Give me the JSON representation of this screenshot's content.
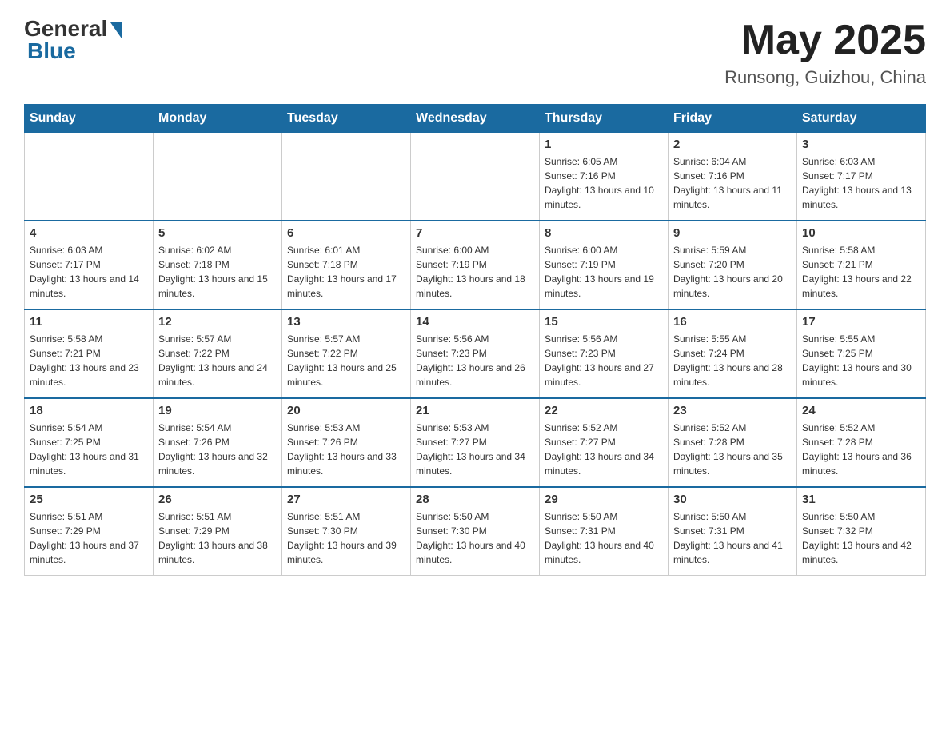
{
  "header": {
    "logo_general": "General",
    "logo_blue": "Blue",
    "month_title": "May 2025",
    "location": "Runsong, Guizhou, China"
  },
  "weekdays": [
    "Sunday",
    "Monday",
    "Tuesday",
    "Wednesday",
    "Thursday",
    "Friday",
    "Saturday"
  ],
  "weeks": [
    [
      {
        "day": "",
        "sunrise": "",
        "sunset": "",
        "daylight": ""
      },
      {
        "day": "",
        "sunrise": "",
        "sunset": "",
        "daylight": ""
      },
      {
        "day": "",
        "sunrise": "",
        "sunset": "",
        "daylight": ""
      },
      {
        "day": "",
        "sunrise": "",
        "sunset": "",
        "daylight": ""
      },
      {
        "day": "1",
        "sunrise": "Sunrise: 6:05 AM",
        "sunset": "Sunset: 7:16 PM",
        "daylight": "Daylight: 13 hours and 10 minutes."
      },
      {
        "day": "2",
        "sunrise": "Sunrise: 6:04 AM",
        "sunset": "Sunset: 7:16 PM",
        "daylight": "Daylight: 13 hours and 11 minutes."
      },
      {
        "day": "3",
        "sunrise": "Sunrise: 6:03 AM",
        "sunset": "Sunset: 7:17 PM",
        "daylight": "Daylight: 13 hours and 13 minutes."
      }
    ],
    [
      {
        "day": "4",
        "sunrise": "Sunrise: 6:03 AM",
        "sunset": "Sunset: 7:17 PM",
        "daylight": "Daylight: 13 hours and 14 minutes."
      },
      {
        "day": "5",
        "sunrise": "Sunrise: 6:02 AM",
        "sunset": "Sunset: 7:18 PM",
        "daylight": "Daylight: 13 hours and 15 minutes."
      },
      {
        "day": "6",
        "sunrise": "Sunrise: 6:01 AM",
        "sunset": "Sunset: 7:18 PM",
        "daylight": "Daylight: 13 hours and 17 minutes."
      },
      {
        "day": "7",
        "sunrise": "Sunrise: 6:00 AM",
        "sunset": "Sunset: 7:19 PM",
        "daylight": "Daylight: 13 hours and 18 minutes."
      },
      {
        "day": "8",
        "sunrise": "Sunrise: 6:00 AM",
        "sunset": "Sunset: 7:19 PM",
        "daylight": "Daylight: 13 hours and 19 minutes."
      },
      {
        "day": "9",
        "sunrise": "Sunrise: 5:59 AM",
        "sunset": "Sunset: 7:20 PM",
        "daylight": "Daylight: 13 hours and 20 minutes."
      },
      {
        "day": "10",
        "sunrise": "Sunrise: 5:58 AM",
        "sunset": "Sunset: 7:21 PM",
        "daylight": "Daylight: 13 hours and 22 minutes."
      }
    ],
    [
      {
        "day": "11",
        "sunrise": "Sunrise: 5:58 AM",
        "sunset": "Sunset: 7:21 PM",
        "daylight": "Daylight: 13 hours and 23 minutes."
      },
      {
        "day": "12",
        "sunrise": "Sunrise: 5:57 AM",
        "sunset": "Sunset: 7:22 PM",
        "daylight": "Daylight: 13 hours and 24 minutes."
      },
      {
        "day": "13",
        "sunrise": "Sunrise: 5:57 AM",
        "sunset": "Sunset: 7:22 PM",
        "daylight": "Daylight: 13 hours and 25 minutes."
      },
      {
        "day": "14",
        "sunrise": "Sunrise: 5:56 AM",
        "sunset": "Sunset: 7:23 PM",
        "daylight": "Daylight: 13 hours and 26 minutes."
      },
      {
        "day": "15",
        "sunrise": "Sunrise: 5:56 AM",
        "sunset": "Sunset: 7:23 PM",
        "daylight": "Daylight: 13 hours and 27 minutes."
      },
      {
        "day": "16",
        "sunrise": "Sunrise: 5:55 AM",
        "sunset": "Sunset: 7:24 PM",
        "daylight": "Daylight: 13 hours and 28 minutes."
      },
      {
        "day": "17",
        "sunrise": "Sunrise: 5:55 AM",
        "sunset": "Sunset: 7:25 PM",
        "daylight": "Daylight: 13 hours and 30 minutes."
      }
    ],
    [
      {
        "day": "18",
        "sunrise": "Sunrise: 5:54 AM",
        "sunset": "Sunset: 7:25 PM",
        "daylight": "Daylight: 13 hours and 31 minutes."
      },
      {
        "day": "19",
        "sunrise": "Sunrise: 5:54 AM",
        "sunset": "Sunset: 7:26 PM",
        "daylight": "Daylight: 13 hours and 32 minutes."
      },
      {
        "day": "20",
        "sunrise": "Sunrise: 5:53 AM",
        "sunset": "Sunset: 7:26 PM",
        "daylight": "Daylight: 13 hours and 33 minutes."
      },
      {
        "day": "21",
        "sunrise": "Sunrise: 5:53 AM",
        "sunset": "Sunset: 7:27 PM",
        "daylight": "Daylight: 13 hours and 34 minutes."
      },
      {
        "day": "22",
        "sunrise": "Sunrise: 5:52 AM",
        "sunset": "Sunset: 7:27 PM",
        "daylight": "Daylight: 13 hours and 34 minutes."
      },
      {
        "day": "23",
        "sunrise": "Sunrise: 5:52 AM",
        "sunset": "Sunset: 7:28 PM",
        "daylight": "Daylight: 13 hours and 35 minutes."
      },
      {
        "day": "24",
        "sunrise": "Sunrise: 5:52 AM",
        "sunset": "Sunset: 7:28 PM",
        "daylight": "Daylight: 13 hours and 36 minutes."
      }
    ],
    [
      {
        "day": "25",
        "sunrise": "Sunrise: 5:51 AM",
        "sunset": "Sunset: 7:29 PM",
        "daylight": "Daylight: 13 hours and 37 minutes."
      },
      {
        "day": "26",
        "sunrise": "Sunrise: 5:51 AM",
        "sunset": "Sunset: 7:29 PM",
        "daylight": "Daylight: 13 hours and 38 minutes."
      },
      {
        "day": "27",
        "sunrise": "Sunrise: 5:51 AM",
        "sunset": "Sunset: 7:30 PM",
        "daylight": "Daylight: 13 hours and 39 minutes."
      },
      {
        "day": "28",
        "sunrise": "Sunrise: 5:50 AM",
        "sunset": "Sunset: 7:30 PM",
        "daylight": "Daylight: 13 hours and 40 minutes."
      },
      {
        "day": "29",
        "sunrise": "Sunrise: 5:50 AM",
        "sunset": "Sunset: 7:31 PM",
        "daylight": "Daylight: 13 hours and 40 minutes."
      },
      {
        "day": "30",
        "sunrise": "Sunrise: 5:50 AM",
        "sunset": "Sunset: 7:31 PM",
        "daylight": "Daylight: 13 hours and 41 minutes."
      },
      {
        "day": "31",
        "sunrise": "Sunrise: 5:50 AM",
        "sunset": "Sunset: 7:32 PM",
        "daylight": "Daylight: 13 hours and 42 minutes."
      }
    ]
  ]
}
